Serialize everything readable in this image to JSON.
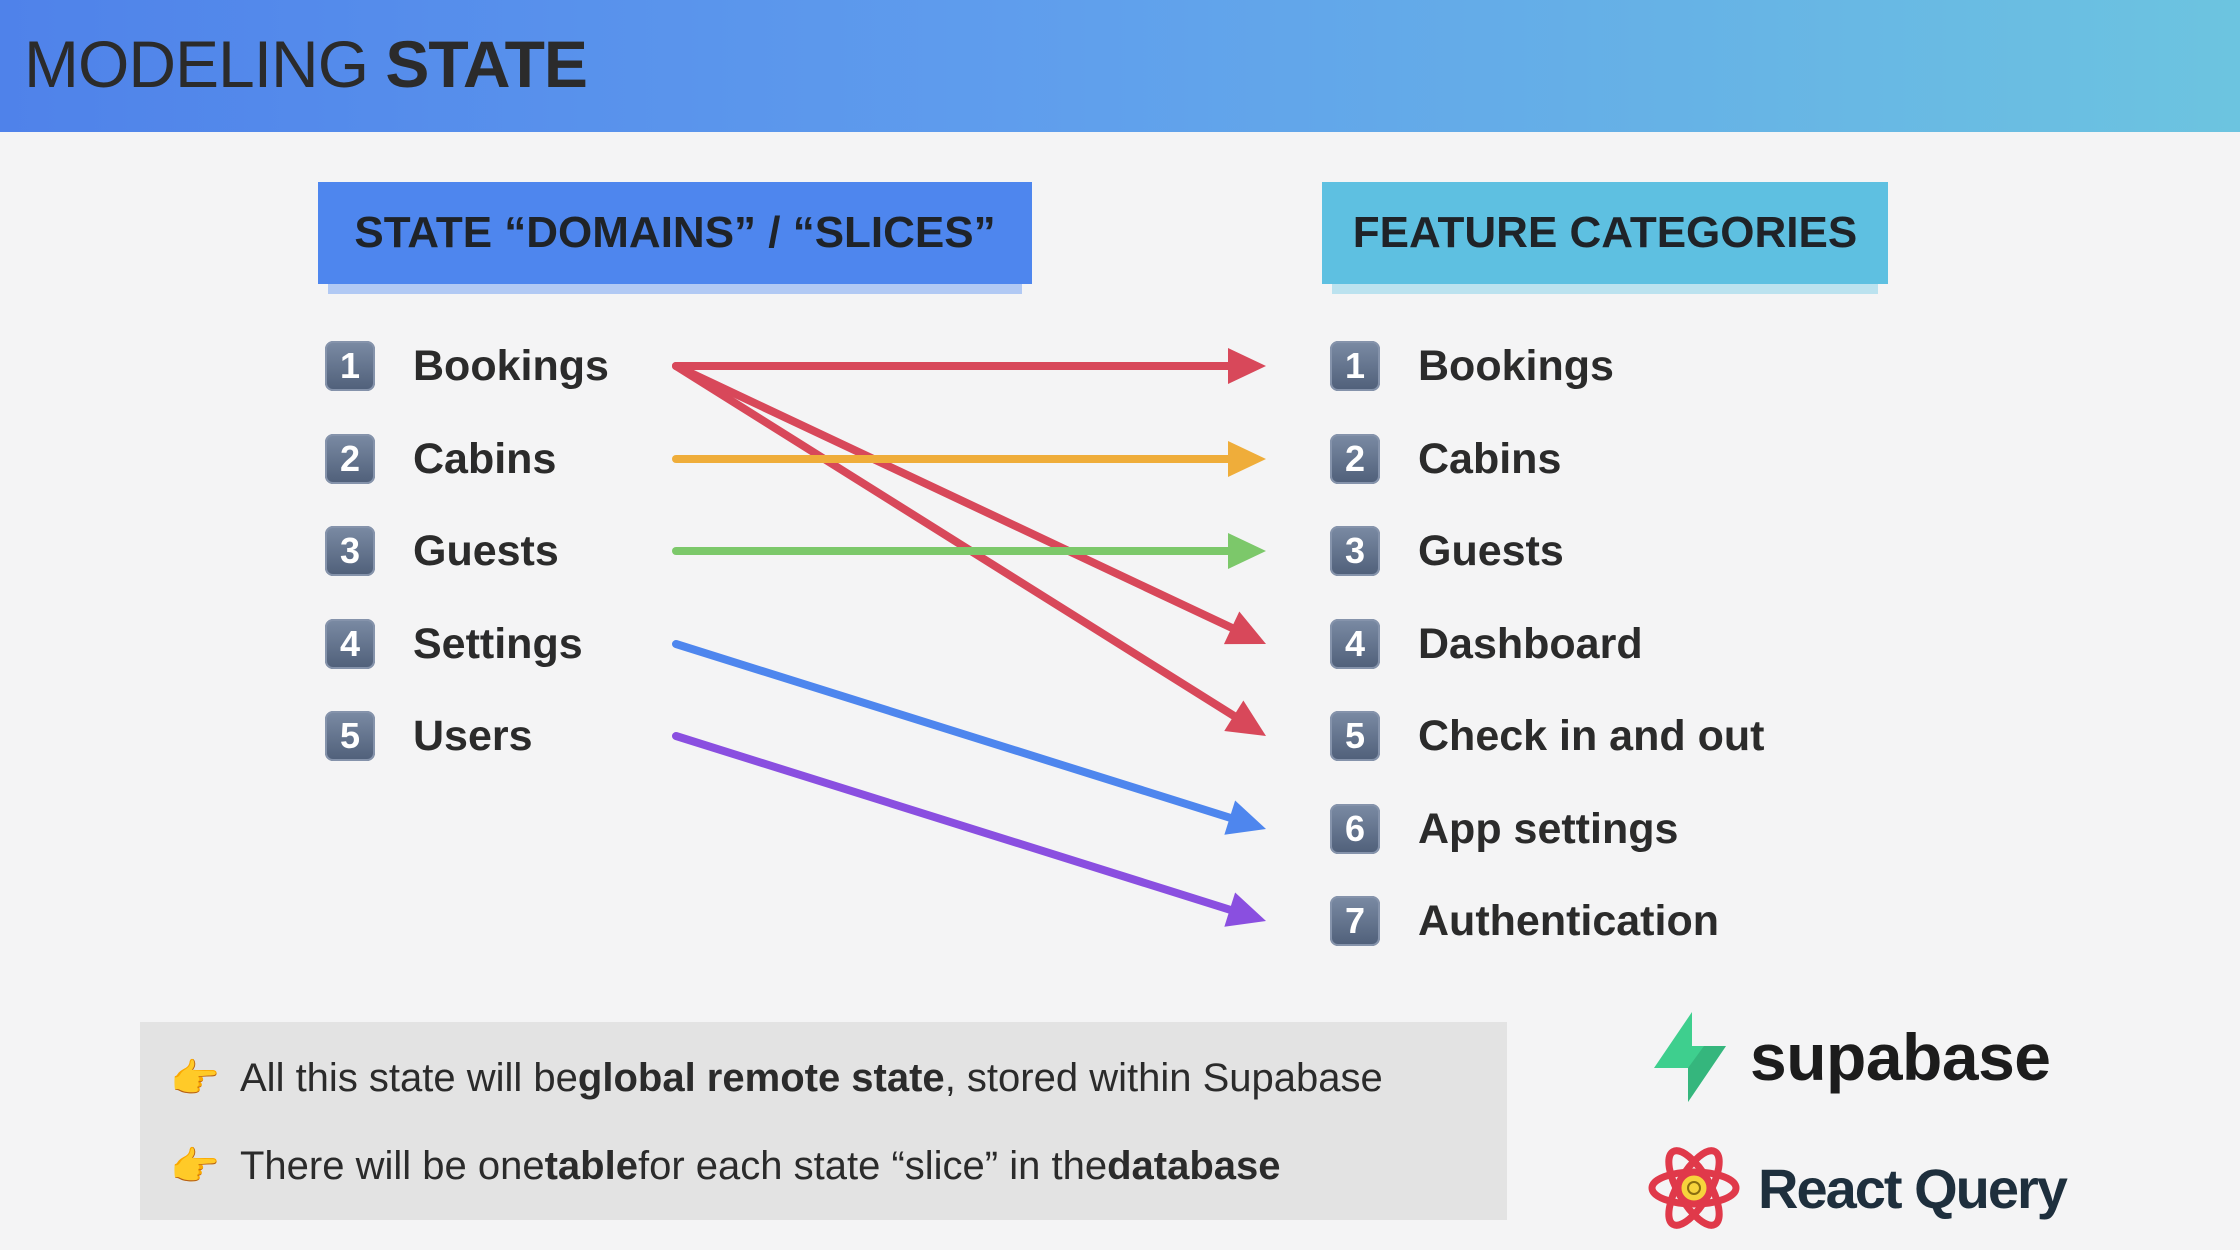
{
  "title": {
    "light": "MODELING",
    "bold": "STATE"
  },
  "left_column": {
    "header": "STATE “DOMAINS” / “SLICES”",
    "items": [
      {
        "num": "1",
        "label": "Bookings"
      },
      {
        "num": "2",
        "label": "Cabins"
      },
      {
        "num": "3",
        "label": "Guests"
      },
      {
        "num": "4",
        "label": "Settings"
      },
      {
        "num": "5",
        "label": "Users"
      }
    ]
  },
  "right_column": {
    "header": "FEATURE CATEGORIES",
    "items": [
      {
        "num": "1",
        "label": "Bookings"
      },
      {
        "num": "2",
        "label": "Cabins"
      },
      {
        "num": "3",
        "label": "Guests"
      },
      {
        "num": "4",
        "label": "Dashboard"
      },
      {
        "num": "5",
        "label": "Check in and out"
      },
      {
        "num": "6",
        "label": "App settings"
      },
      {
        "num": "7",
        "label": "Authentication"
      }
    ]
  },
  "connections": [
    {
      "from": "Bookings",
      "to": "Bookings",
      "color": "#d8485a"
    },
    {
      "from": "Bookings",
      "to": "Dashboard",
      "color": "#d8485a"
    },
    {
      "from": "Bookings",
      "to": "Check in and out",
      "color": "#d8485a"
    },
    {
      "from": "Cabins",
      "to": "Cabins",
      "color": "#efad3a"
    },
    {
      "from": "Guests",
      "to": "Guests",
      "color": "#7cc86a"
    },
    {
      "from": "Settings",
      "to": "App settings",
      "color": "#4e86ee"
    },
    {
      "from": "Users",
      "to": "Authentication",
      "color": "#8a4fe0"
    }
  ],
  "notes": [
    {
      "icon": "👉",
      "p1": "All this state will be ",
      "b1": "global remote state",
      "p2": ", stored within Supabase",
      "b2": "",
      "p3": ""
    },
    {
      "icon": "👉",
      "p1": "There will be one ",
      "b1": "table",
      "p2": " for each state “slice” in the ",
      "b2": "database",
      "p3": ""
    }
  ],
  "logos": {
    "supabase": "supabase",
    "react_query": "React Query"
  },
  "colors": {
    "banner_start": "#4f82ea",
    "banner_end": "#6cc4e0",
    "left_header": "#4e86ee",
    "right_header": "#5ec0e1"
  }
}
